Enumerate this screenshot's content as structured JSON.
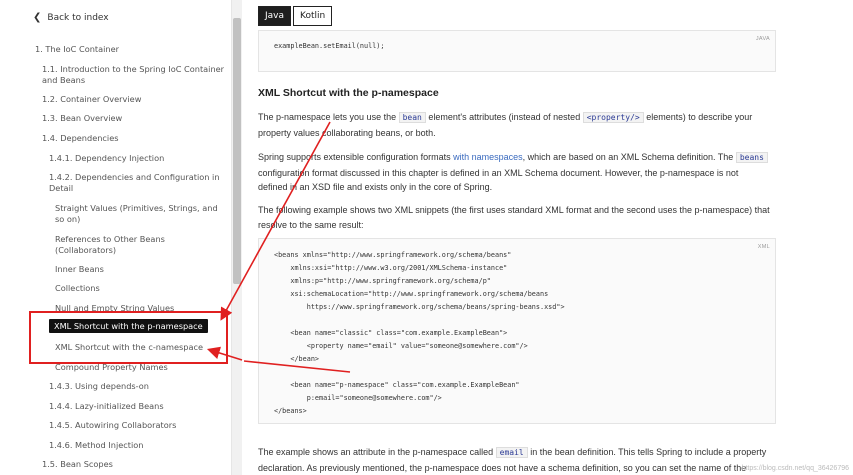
{
  "sidebar": {
    "back_label": "Back to index",
    "items": [
      {
        "label": "1. The IoC Container"
      },
      {
        "label": "1.1. Introduction to the Spring IoC Container"
      },
      {
        "label": "and Beans"
      },
      {
        "label": "1.2. Container Overview"
      },
      {
        "label": "1.3. Bean Overview"
      },
      {
        "label": "1.4. Dependencies"
      },
      {
        "label": "1.4.1. Dependency Injection"
      },
      {
        "label": "1.4.2. Dependencies and Configuration in"
      },
      {
        "label": "Detail"
      },
      {
        "label": "Straight Values (Primitives, Strings, and"
      },
      {
        "label": "so on)"
      },
      {
        "label": "References to Other Beans"
      },
      {
        "label": "(Collaborators)"
      },
      {
        "label": "Inner Beans"
      },
      {
        "label": "Collections"
      },
      {
        "label": "Null and Empty String Values"
      },
      {
        "label": "XML Shortcut with the p-namespace"
      },
      {
        "label": "XML Shortcut with the c-namespace"
      },
      {
        "label": "Compound Property Names"
      },
      {
        "label": "1.4.3. Using depends-on"
      },
      {
        "label": "1.4.4. Lazy-initialized Beans"
      },
      {
        "label": "1.4.5. Autowiring Collaborators"
      },
      {
        "label": "1.4.6. Method Injection"
      },
      {
        "label": "1.5. Bean Scopes"
      }
    ]
  },
  "main": {
    "tabs": [
      {
        "label": "Java"
      },
      {
        "label": "Kotlin"
      }
    ],
    "code1": {
      "lang": "JAVA",
      "line": "exampleBean.setEmail(null);"
    },
    "heading": "XML Shortcut with the p-namespace",
    "p1": {
      "a": "The p-namespace lets you use the",
      "code_bean": "bean",
      "b": "element's attributes (instead of nested",
      "code_property": "<property/>",
      "c": "elements) to describe your",
      "d": "property values collaborating beans, or both."
    },
    "p2": {
      "a": "Spring supports extensible configuration formats",
      "link": "with namespaces",
      "b": ", which are based on an XML Schema definition. The",
      "code_beans": "beans",
      "c": "configuration format discussed in this chapter is defined in an XML Schema document. However, the p-namespace is not",
      "d": "defined in an XSD file and exists only in the core of Spring."
    },
    "p3": {
      "a": "The following example shows two XML snippets (the first uses standard XML format and the second uses the p-namespace) that",
      "b": "resolve to the same result:"
    },
    "code2": {
      "lang": "XML",
      "lines": [
        "<beans xmlns=\"http://www.springframework.org/schema/beans\"",
        "    xmlns:xsi=\"http://www.w3.org/2001/XMLSchema-instance\"",
        "    xmlns:p=\"http://www.springframework.org/schema/p\"",
        "    xsi:schemaLocation=\"http://www.springframework.org/schema/beans",
        "        https://www.springframework.org/schema/beans/spring-beans.xsd\">",
        "",
        "    <bean name=\"classic\" class=\"com.example.ExampleBean\">",
        "        <property name=\"email\" value=\"someone@somewhere.com\"/>",
        "    </bean>",
        "",
        "    <bean name=\"p-namespace\" class=\"com.example.ExampleBean\"",
        "        p:email=\"someone@somewhere.com\"/>",
        "</beans>"
      ]
    },
    "p4": {
      "a": "The example shows an attribute in the p-namespace called",
      "code_email": "email",
      "b": "in the bean definition. This tells Spring to include a property",
      "c": "declaration. As previously mentioned, the p-namespace does not have a schema definition, so you can set the name of the"
    }
  },
  "watermark": "https://blog.csdn.net/qq_36426796",
  "colors": {
    "annotation": "#e02020",
    "active_nav": "#111111"
  }
}
